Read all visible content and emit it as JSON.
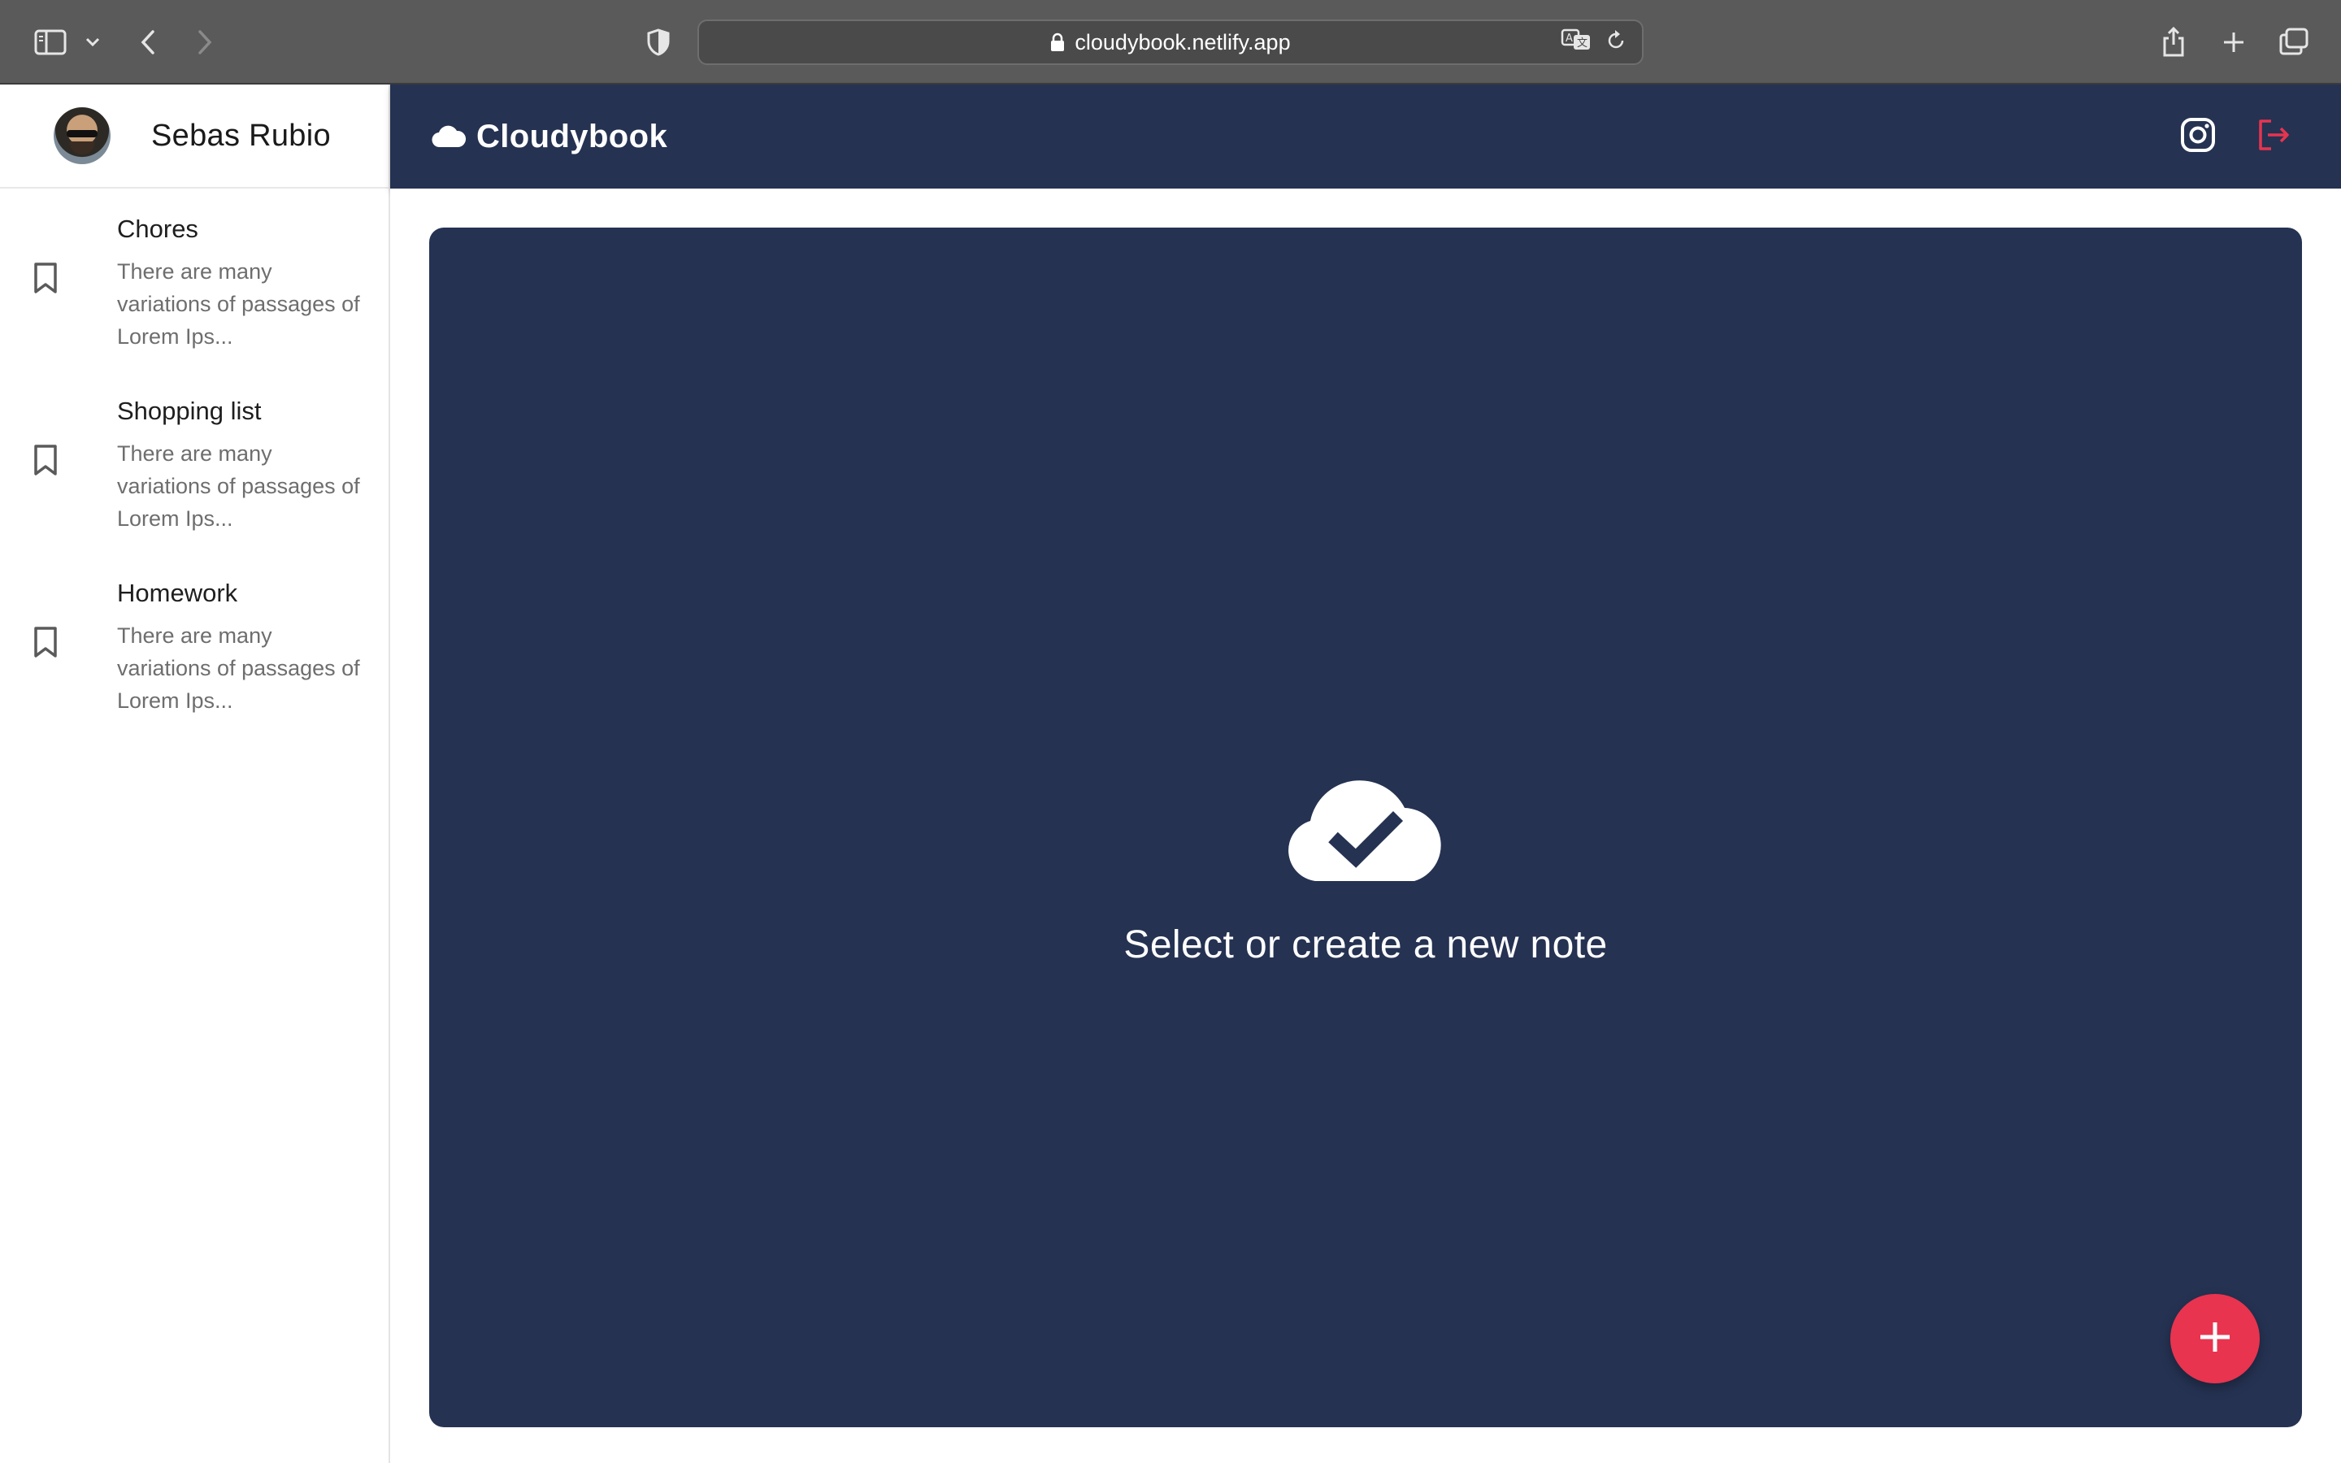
{
  "browser": {
    "url": "cloudybook.netlify.app"
  },
  "sidebar": {
    "user_name": "Sebas Rubio",
    "notes": [
      {
        "title": "Chores",
        "preview": "There are many variations of passages of Lorem Ips..."
      },
      {
        "title": "Shopping list",
        "preview": "There are many variations of passages of Lorem Ips..."
      },
      {
        "title": "Homework",
        "preview": "There are many variations of passages of Lorem Ips..."
      }
    ]
  },
  "header": {
    "brand": "Cloudybook"
  },
  "main": {
    "empty_message": "Select or create a new note"
  },
  "colors": {
    "navy": "#253252",
    "accent": "#e8344f",
    "chrome": "#5a5a5a"
  },
  "icons": {
    "browser": [
      "sidebar-toggle-icon",
      "chevron-down-icon",
      "back-icon",
      "forward-icon",
      "shield-icon",
      "lock-icon",
      "translate-icon",
      "reload-icon",
      "share-icon",
      "new-tab-icon",
      "tabs-overview-icon"
    ],
    "app": [
      "cloud-icon",
      "instagram-icon",
      "logout-icon",
      "bookmark-icon",
      "cloud-check-icon",
      "plus-icon"
    ]
  }
}
